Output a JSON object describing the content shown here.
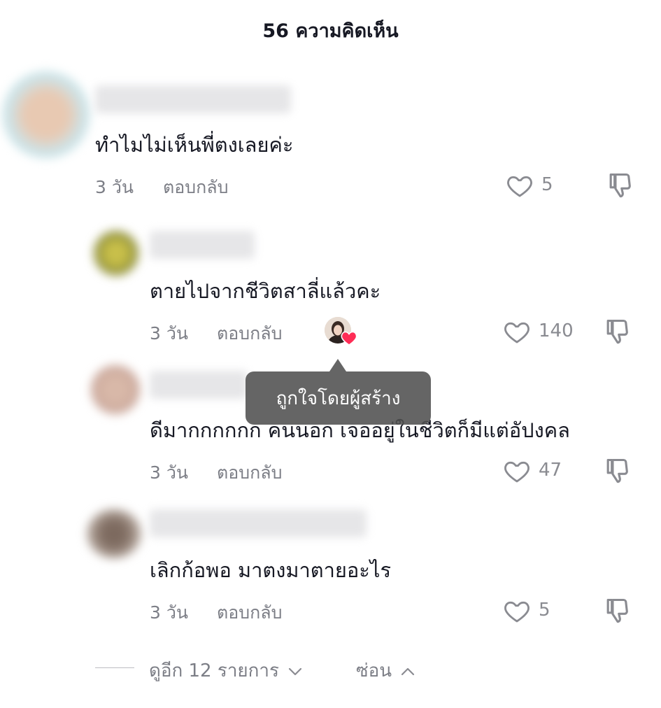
{
  "header": {
    "title": "56 ความคิดเห็น"
  },
  "comments": [
    {
      "text": "ทำไมไม่เห็นพี่ตงเลยค่ะ",
      "time": "3 วัน",
      "reply": "ตอบกลับ",
      "likes": "5"
    },
    {
      "text": "ตายไปจากชีวิตสาลี่แล้วคะ",
      "time": "3 วัน",
      "reply": "ตอบกลับ",
      "likes": "140"
    },
    {
      "text": "ดีมากกกกกก คนนอก เจออยู่ในชีวิตก็มีแต่อัปงคล",
      "time": "3 วัน",
      "reply": "ตอบกลับ",
      "likes": "47"
    },
    {
      "text": "เลิกก้อพอ มาตงมาตายอะไร",
      "time": "3 วัน",
      "reply": "ตอบกลับ",
      "likes": "5"
    }
  ],
  "tooltip": {
    "text": "ถูกใจโดยผู้สร้าง"
  },
  "footer": {
    "view_more": "ดูอีก 12 รายการ",
    "hide": "ซ่อน"
  },
  "icons": {
    "like": "heart-outline-icon",
    "dislike": "thumbs-down-icon",
    "creator_heart": "heart-filled-icon",
    "chevron_down": "chevron-down-icon",
    "chevron_up": "chevron-up-icon"
  },
  "colors": {
    "text": "#161823",
    "secondary": "#7c7e86",
    "creator_heart": "#fe2c55",
    "tooltip_bg": "#505050"
  }
}
